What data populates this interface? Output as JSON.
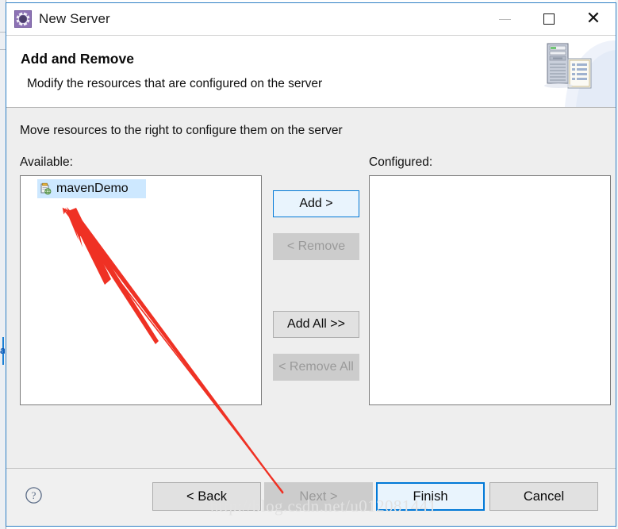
{
  "window": {
    "title": "New Server",
    "icon": "gear-icon",
    "controls": {
      "minimize_label": "Minimize",
      "maximize_label": "Maximize",
      "close_label": "Close"
    }
  },
  "header": {
    "title": "Add and Remove",
    "subtitle": "Modify the resources that are configured on the server",
    "art_icon": "server-document-icon"
  },
  "main": {
    "instruction": "Move resources to the right to configure them on the server",
    "available": {
      "label": "Available:",
      "items": [
        {
          "name": "mavenDemo",
          "icon": "web-project-icon",
          "selected": true
        }
      ]
    },
    "configured": {
      "label": "Configured:",
      "items": []
    },
    "transfer_buttons": [
      {
        "label": "Add >",
        "state": "focused",
        "name": "add-button"
      },
      {
        "label": "< Remove",
        "state": "disabled",
        "name": "remove-button"
      },
      {
        "label": "Add All >>",
        "state": "default",
        "name": "add-all-button"
      },
      {
        "label": "< Remove All",
        "state": "disabled",
        "name": "remove-all-button"
      }
    ]
  },
  "footer": {
    "help_icon": "question-mark-icon",
    "buttons": [
      {
        "label": "< Back",
        "state": "default",
        "name": "back-button"
      },
      {
        "label": "Next >",
        "state": "disabled",
        "name": "next-button"
      },
      {
        "label": "Finish",
        "state": "focused",
        "name": "finish-button"
      },
      {
        "label": "Cancel",
        "state": "default",
        "name": "cancel-button"
      }
    ]
  },
  "overlay": {
    "watermark": "http://blog.csdn.net/u012081441",
    "arrow_color": "#ef3124"
  },
  "backdrop": {
    "fragment_text": "a"
  }
}
